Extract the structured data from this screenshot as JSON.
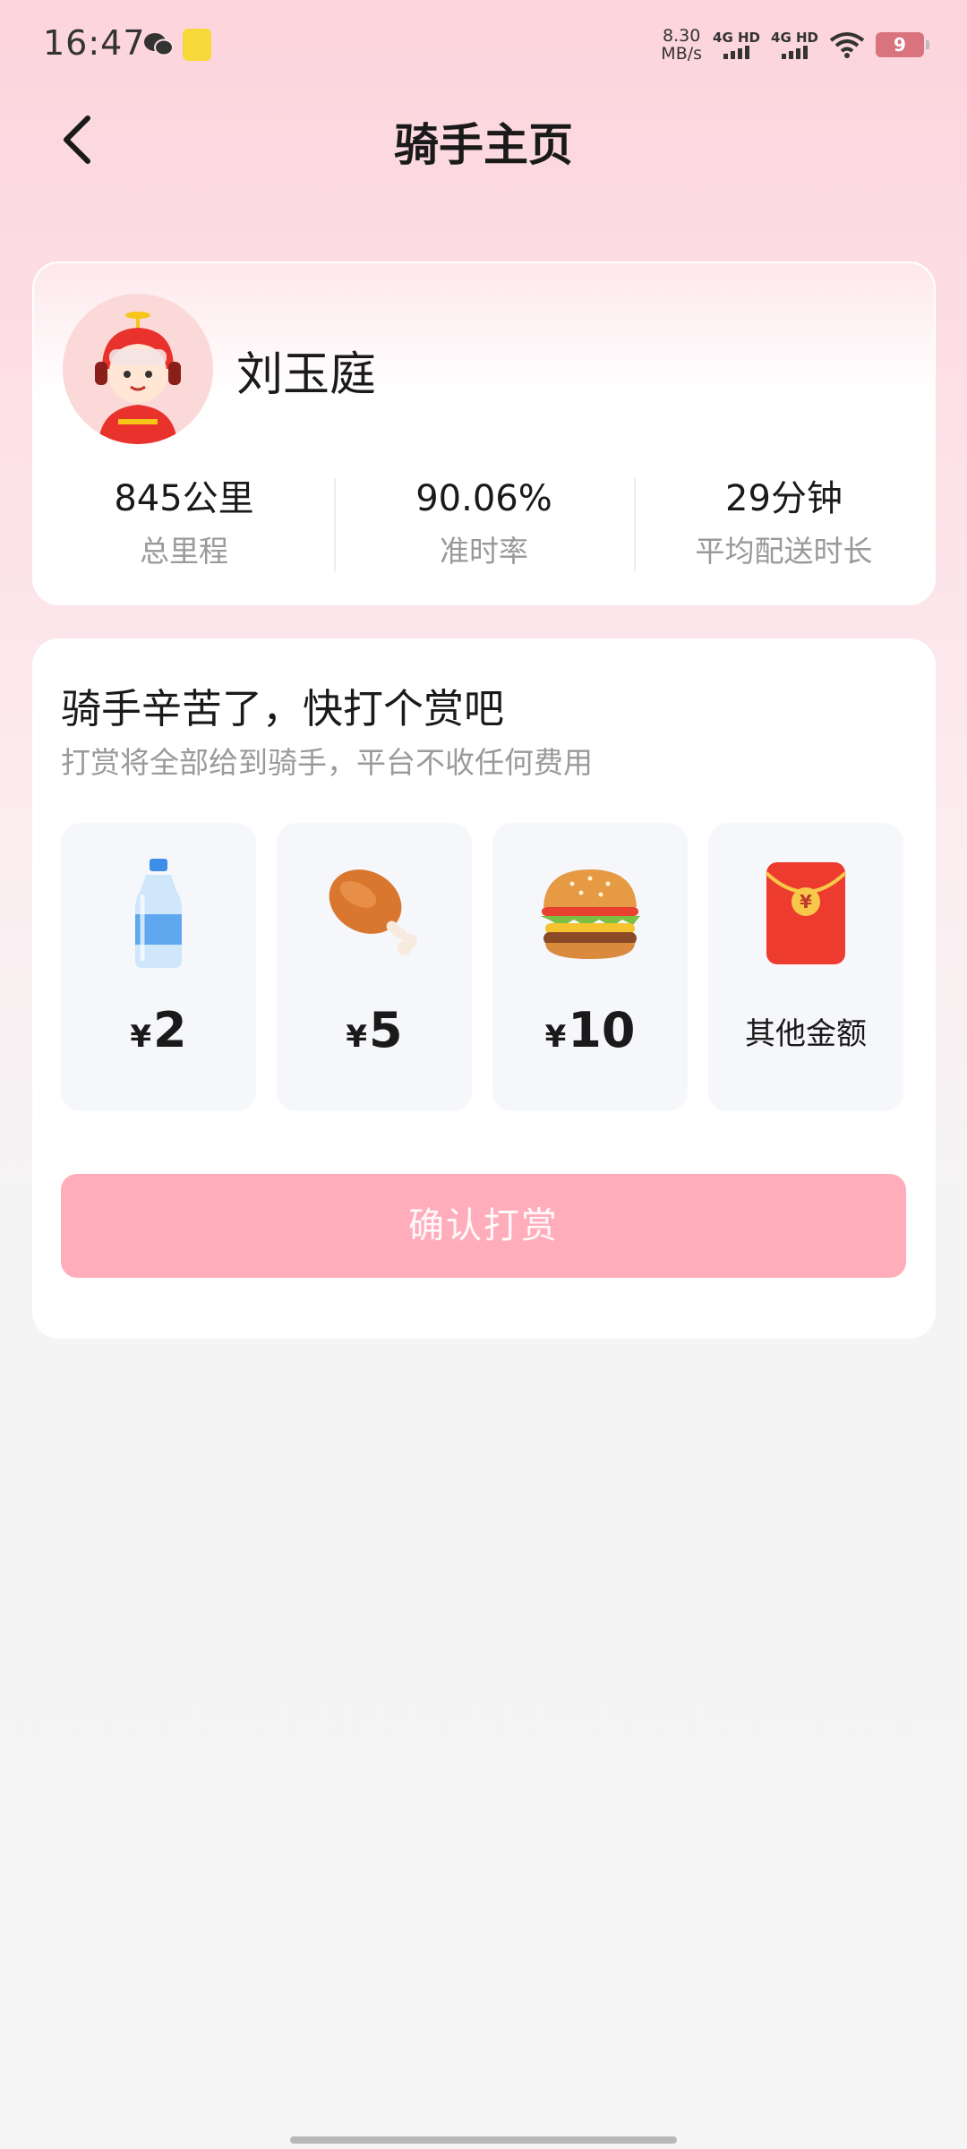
{
  "status_bar": {
    "time": "16:47",
    "net_speed_value": "8.30",
    "net_speed_unit": "MB/s",
    "sim1_label": "4G HD",
    "sim2_label": "4G HD",
    "battery": "9"
  },
  "header": {
    "title": "骑手主页",
    "back_icon": "chevron-left-icon"
  },
  "rider": {
    "name": "刘玉庭",
    "stats": [
      {
        "value": "845公里",
        "label": "总里程"
      },
      {
        "value": "90.06%",
        "label": "准时率"
      },
      {
        "value": "29分钟",
        "label": "平均配送时长"
      }
    ]
  },
  "tip": {
    "title": "骑手辛苦了，快打个赏吧",
    "subtitle": "打赏将全部给到骑手，平台不收任何费用",
    "options": [
      {
        "icon": "water-bottle-icon",
        "currency": "¥",
        "amount": "2"
      },
      {
        "icon": "chicken-leg-icon",
        "currency": "¥",
        "amount": "5"
      },
      {
        "icon": "burger-icon",
        "currency": "¥",
        "amount": "10"
      },
      {
        "icon": "red-envelope-icon",
        "label": "其他金额"
      }
    ],
    "confirm_label": "确认打赏"
  },
  "colors": {
    "accent": "#ffadbb",
    "background_top": "#fcd4dc",
    "background_bottom": "#f5f5f5"
  }
}
